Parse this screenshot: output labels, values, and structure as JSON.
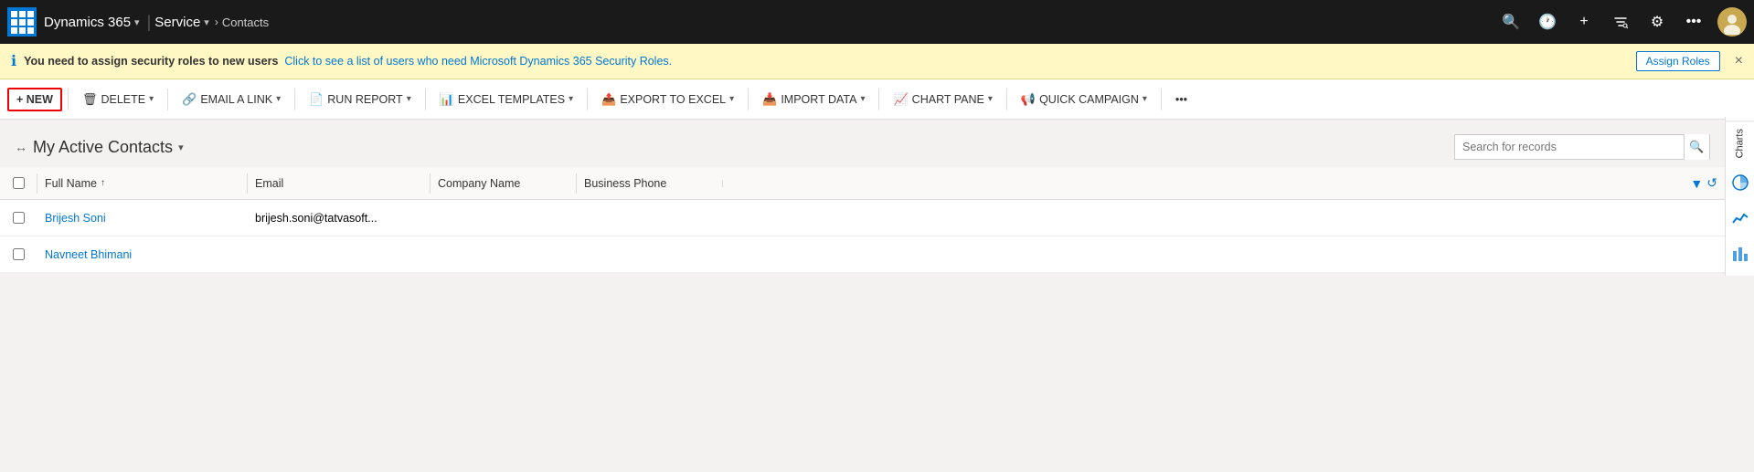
{
  "topnav": {
    "brand": "Dynamics 365",
    "brand_chevron": "▾",
    "module": "Service",
    "module_chevron": "▾",
    "breadcrumb": "Contacts",
    "breadcrumb_arrow": "›",
    "search_tooltip": "Search",
    "history_tooltip": "Recent items",
    "add_tooltip": "Create",
    "filter_tooltip": "Advanced find",
    "settings_tooltip": "Settings",
    "more_tooltip": "More options",
    "avatar_initials": ""
  },
  "notification": {
    "text_bold": "You need to assign security roles to new users",
    "text_link": "Click to see a list of users who need Microsoft Dynamics 365 Security Roles.",
    "assign_label": "Assign Roles",
    "close_label": "×"
  },
  "toolbar": {
    "new_label": "+ NEW",
    "delete_label": "DELETE",
    "email_link_label": "EMAIL A LINK",
    "run_report_label": "RUN REPORT",
    "excel_templates_label": "EXCEL TEMPLATES",
    "export_excel_label": "EXPORT TO EXCEL",
    "import_data_label": "IMPORT DATA",
    "chart_pane_label": "CHART PANE",
    "quick_campaign_label": "QUICK CAMPAIGN",
    "more_label": "•••"
  },
  "view": {
    "pin_icon": "↔",
    "title": "My Active Contacts",
    "dropdown_icon": "▾",
    "search_placeholder": "Search for records"
  },
  "table": {
    "columns": [
      {
        "id": "fullname",
        "label": "Full Name",
        "sort": "↑"
      },
      {
        "id": "email",
        "label": "Email"
      },
      {
        "id": "company",
        "label": "Company Name"
      },
      {
        "id": "phone",
        "label": "Business Phone"
      }
    ],
    "rows": [
      {
        "fullname": "Brijesh Soni",
        "email": "brijesh.soni@tatvasoft...",
        "company": "",
        "phone": ""
      },
      {
        "fullname": "Navneet Bhimani",
        "email": "",
        "company": "",
        "phone": ""
      }
    ]
  },
  "right_panel": {
    "charts_label": "Charts",
    "pie_icon": "◑",
    "bar_icon": "▦",
    "column_icon": "▮▮"
  }
}
